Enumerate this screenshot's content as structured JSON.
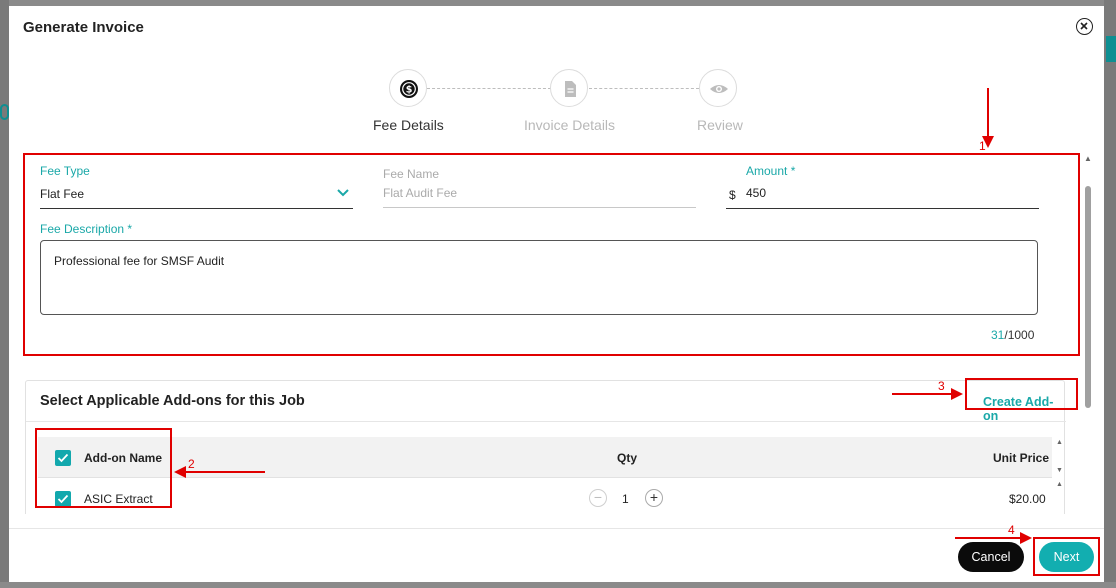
{
  "modal": {
    "title": "Generate Invoice"
  },
  "stepper": {
    "steps": [
      {
        "label": "Fee Details",
        "icon": "dollar-circle-icon",
        "state": "active"
      },
      {
        "label": "Invoice Details",
        "icon": "document-icon",
        "state": "inactive"
      },
      {
        "label": "Review",
        "icon": "eye-icon",
        "state": "inactive"
      }
    ]
  },
  "fee": {
    "fee_type_label": "Fee Type",
    "fee_type_value": "Flat Fee",
    "fee_name_label": "Fee Name",
    "fee_name_value": "Flat Audit Fee",
    "amount_label": "Amount *",
    "currency_symbol": "$",
    "amount_value": "450",
    "description_label": "Fee Description *",
    "description_value": "Professional fee for SMSF Audit",
    "char_count": "31",
    "char_limit": "/1000"
  },
  "addons": {
    "title": "Select Applicable Add-ons for this Job",
    "create_label": "Create Add-on",
    "columns": {
      "name": "Add-on Name",
      "qty": "Qty",
      "unit_price": "Unit Price"
    },
    "rows": [
      {
        "name": "ASIC Extract",
        "qty": "1",
        "unit_price": "$20.00",
        "checked": true
      }
    ]
  },
  "footer": {
    "cancel_label": "Cancel",
    "next_label": "Next"
  },
  "annotations": {
    "n1": "1",
    "n2": "2",
    "n3": "3",
    "n4": "4"
  },
  "colors": {
    "accent": "#12aeb0",
    "annotation": "#e00000",
    "cancel_bg": "#0b0b0b"
  }
}
